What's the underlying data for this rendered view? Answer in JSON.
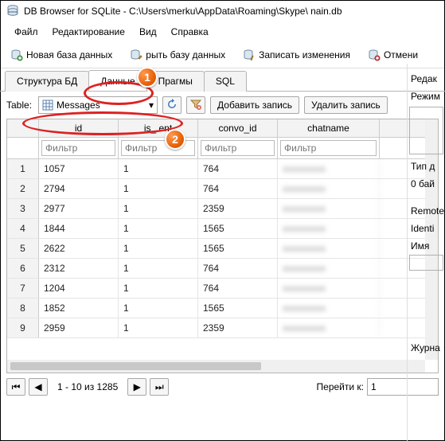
{
  "title": "DB Browser for SQLite - C:\\Users\\merku\\AppData\\Roaming\\Skype\\         nain.db",
  "menu": {
    "file": "Файл",
    "edit": "Редактирование",
    "view": "Вид",
    "help": "Справка"
  },
  "toolbar": {
    "new_db": "Новая база данных",
    "open_db_partial": "рыть базу данных",
    "write_changes": "Записать изменения",
    "revert_partial": "Отмени"
  },
  "tabs": {
    "structure": "Структура БД",
    "data": "Данные",
    "pragmas": "Прагмы",
    "sql": "SQL"
  },
  "table_toolbar": {
    "label": "Table:",
    "selected": "Messages",
    "add_record": "Добавить запись",
    "delete_record": "Удалить запись"
  },
  "columns": {
    "rownum": "",
    "c1": "id",
    "c2": "is_           ent",
    "c3": "convo_id",
    "c4": "chatname"
  },
  "filter_placeholder": "Фильтр",
  "rows": [
    {
      "n": "1",
      "id": "1057",
      "v2": "1",
      "convo": "764"
    },
    {
      "n": "2",
      "id": "2794",
      "v2": "1",
      "convo": "764"
    },
    {
      "n": "3",
      "id": "2977",
      "v2": "1",
      "convo": "2359"
    },
    {
      "n": "4",
      "id": "1844",
      "v2": "1",
      "convo": "1565"
    },
    {
      "n": "5",
      "id": "2622",
      "v2": "1",
      "convo": "1565"
    },
    {
      "n": "6",
      "id": "2312",
      "v2": "1",
      "convo": "764"
    },
    {
      "n": "7",
      "id": "1204",
      "v2": "1",
      "convo": "764"
    },
    {
      "n": "8",
      "id": "1852",
      "v2": "1",
      "convo": "1565"
    },
    {
      "n": "9",
      "id": "2959",
      "v2": "1",
      "convo": "2359"
    }
  ],
  "nav": {
    "range": "1 - 10 из 1285",
    "goto_label": "Перейти к:",
    "goto_value": "1"
  },
  "right": {
    "edit_partial": "Редак",
    "mode": "Режим",
    "type_label": "Тип д",
    "size": "0 бай",
    "remote": "Remote",
    "identity": "Identi",
    "name": "Имя",
    "journal": "Журна"
  },
  "markers": {
    "m1": "1",
    "m2": "2"
  }
}
